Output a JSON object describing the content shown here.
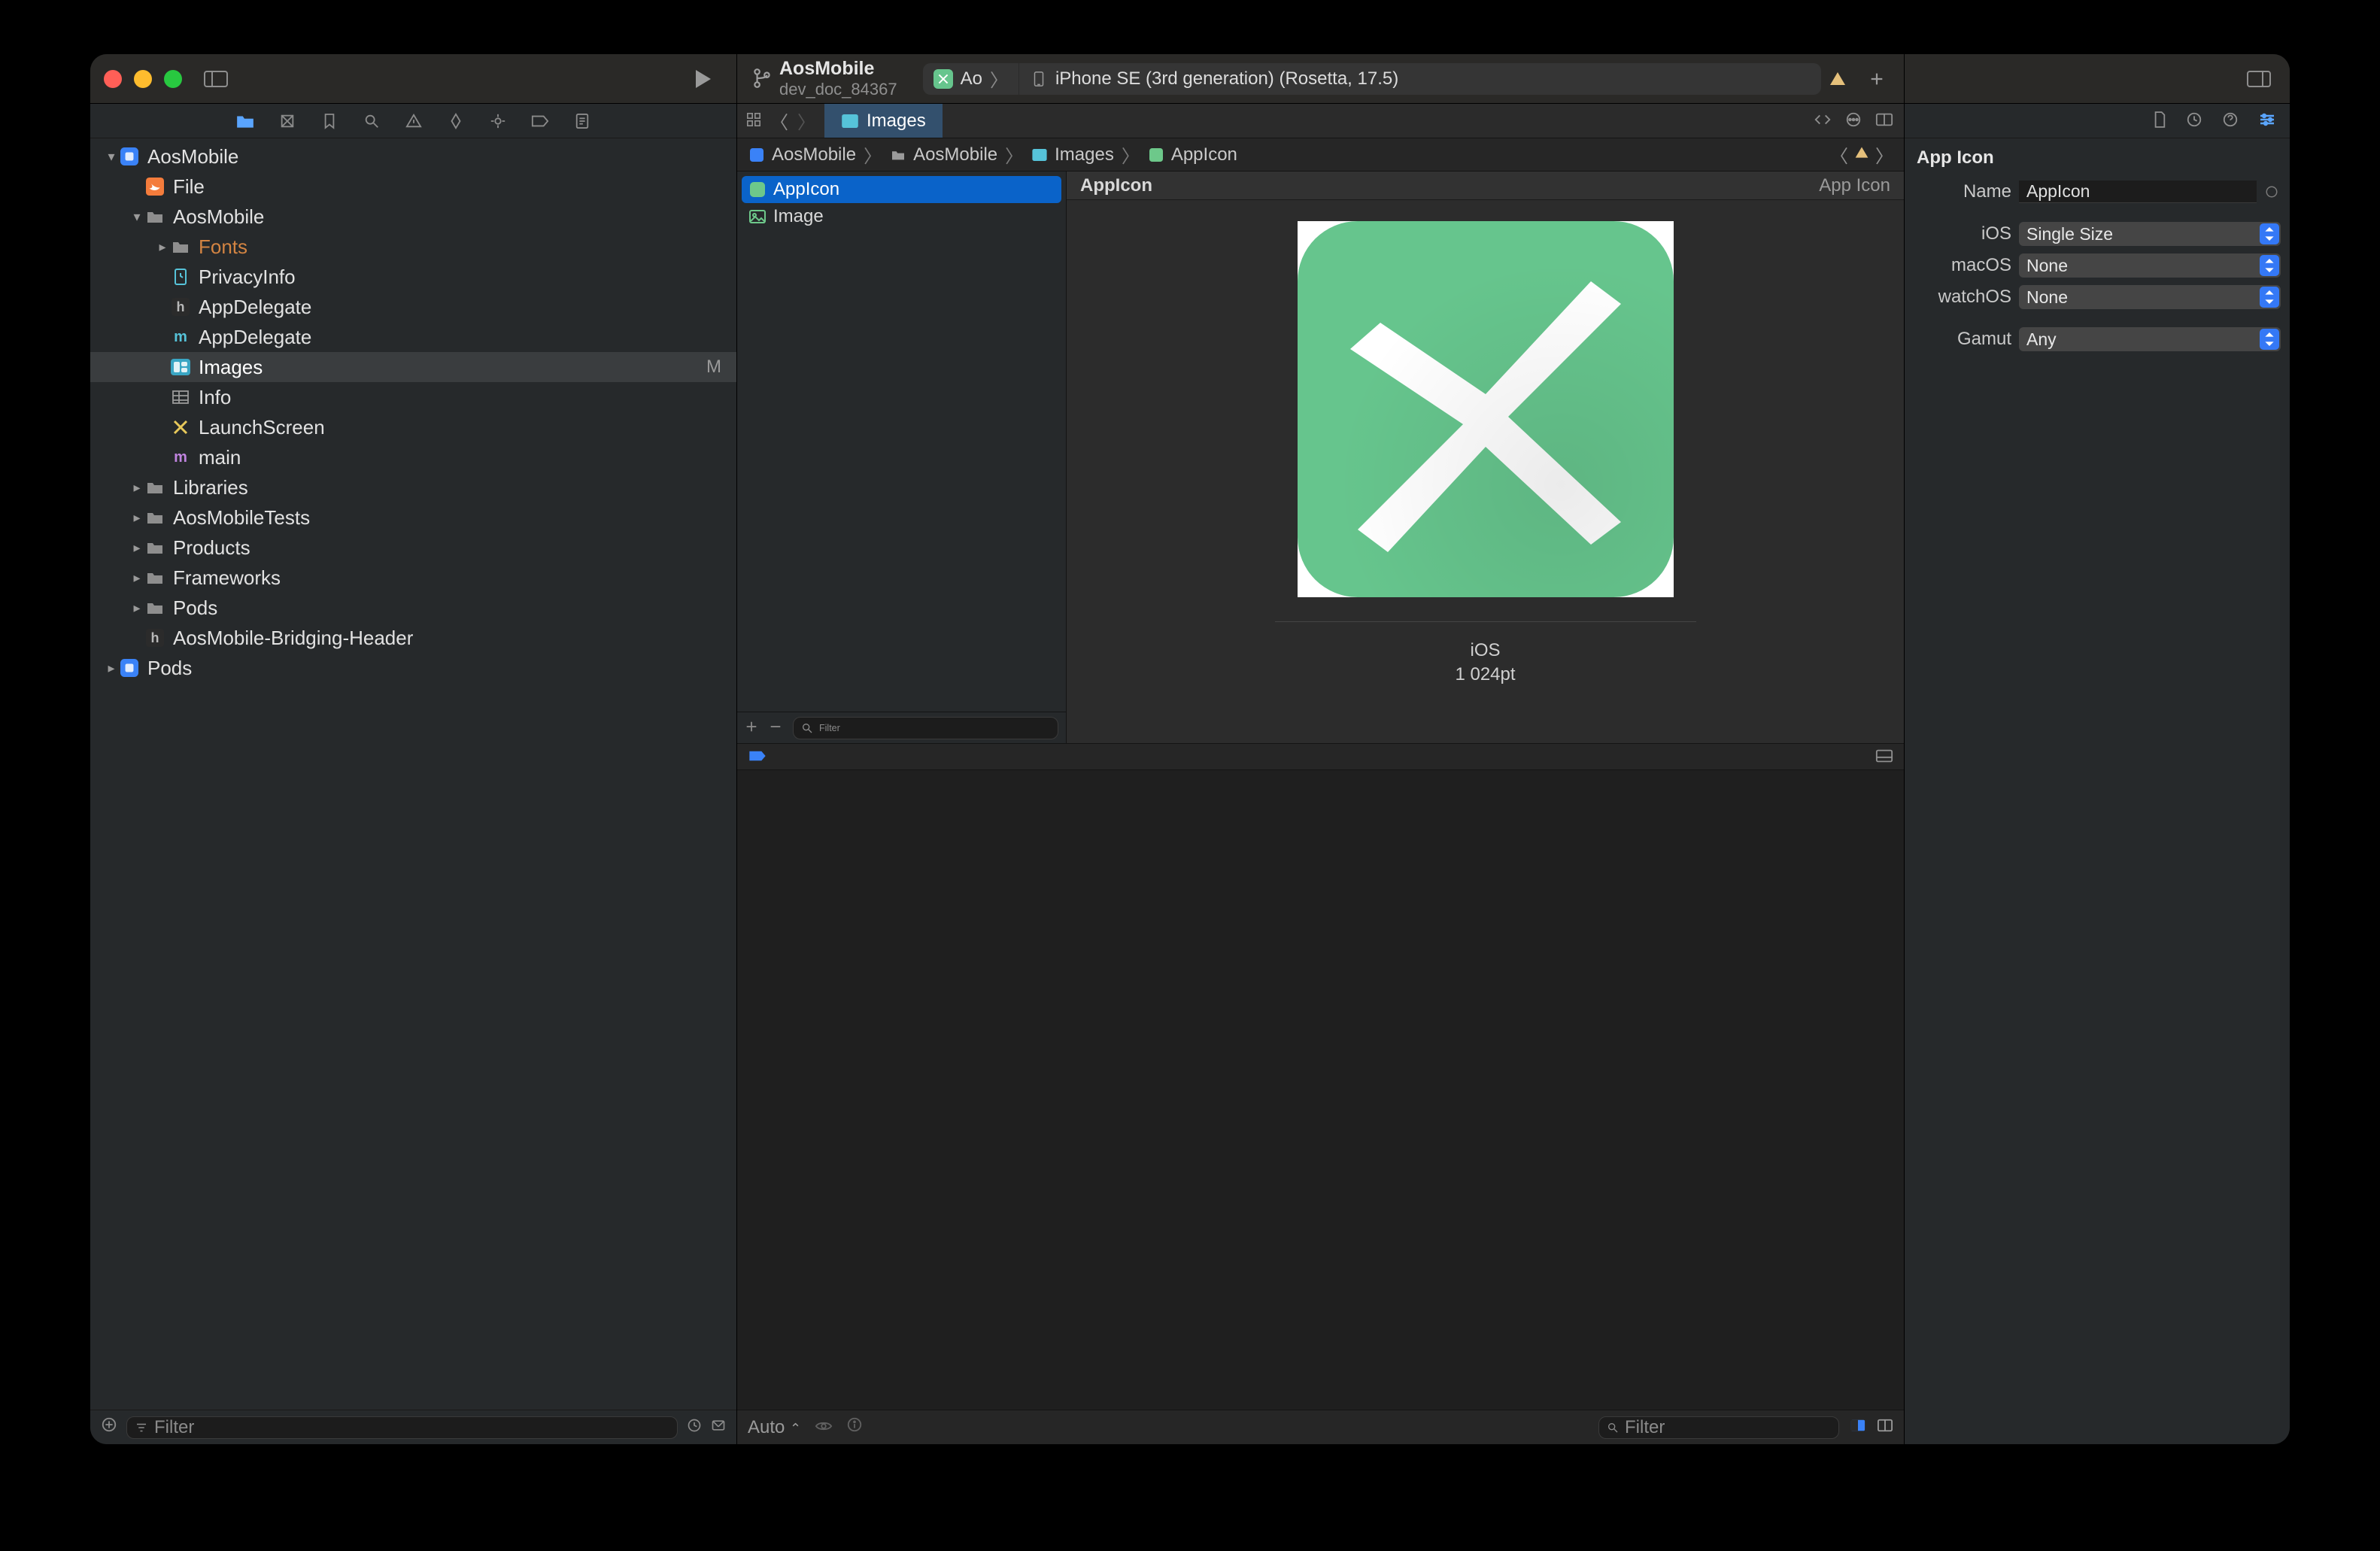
{
  "titlebar": {
    "project": "AosMobile",
    "branch": "dev_doc_84367",
    "scheme_short": "Ao",
    "destination": "iPhone SE (3rd generation) (Rosetta, 17.5)"
  },
  "nav": {
    "filter_placeholder": "Filter",
    "items": [
      {
        "depth": 0,
        "disc": "v",
        "icon": "app-blue",
        "label": "AosMobile"
      },
      {
        "depth": 1,
        "disc": "",
        "icon": "swift",
        "label": "File"
      },
      {
        "depth": 1,
        "disc": "v",
        "icon": "folder",
        "label": "AosMobile"
      },
      {
        "depth": 2,
        "disc": ">",
        "icon": "folder",
        "label": "Fonts",
        "orange": true
      },
      {
        "depth": 2,
        "disc": "",
        "icon": "privacy",
        "label": "PrivacyInfo"
      },
      {
        "depth": 2,
        "disc": "",
        "icon": "h",
        "label": "AppDelegate"
      },
      {
        "depth": 2,
        "disc": "",
        "icon": "m",
        "label": "AppDelegate"
      },
      {
        "depth": 2,
        "disc": "",
        "icon": "assets",
        "label": "Images",
        "selected": true,
        "badge": "M"
      },
      {
        "depth": 2,
        "disc": "",
        "icon": "plist",
        "label": "Info"
      },
      {
        "depth": 2,
        "disc": "",
        "icon": "storyboard",
        "label": "LaunchScreen"
      },
      {
        "depth": 2,
        "disc": "",
        "icon": "m-purple",
        "label": "main"
      },
      {
        "depth": 1,
        "disc": ">",
        "icon": "folder",
        "label": "Libraries"
      },
      {
        "depth": 1,
        "disc": ">",
        "icon": "folder",
        "label": "AosMobileTests"
      },
      {
        "depth": 1,
        "disc": ">",
        "icon": "folder",
        "label": "Products"
      },
      {
        "depth": 1,
        "disc": ">",
        "icon": "folder",
        "label": "Frameworks"
      },
      {
        "depth": 1,
        "disc": ">",
        "icon": "folder",
        "label": "Pods"
      },
      {
        "depth": 1,
        "disc": "",
        "icon": "h",
        "label": "AosMobile-Bridging-Header"
      },
      {
        "depth": 0,
        "disc": ">",
        "icon": "app-blue",
        "label": "Pods"
      }
    ]
  },
  "tabs": {
    "active": "Images"
  },
  "path": {
    "crumbs": [
      "AosMobile",
      "AosMobile",
      "Images",
      "AppIcon"
    ]
  },
  "assets": {
    "items": [
      {
        "label": "AppIcon",
        "selected": true,
        "kind": "appicon"
      },
      {
        "label": "Image",
        "selected": false,
        "kind": "image"
      }
    ],
    "filter_placeholder": "Filter"
  },
  "canvas": {
    "title": "AppIcon",
    "type_label": "App Icon",
    "slot_platform": "iOS",
    "slot_size": "1 024pt"
  },
  "footer": {
    "auto": "Auto",
    "filter_placeholder": "Filter"
  },
  "inspector": {
    "section": "App Icon",
    "name_label": "Name",
    "name_value": "AppIcon",
    "ios_label": "iOS",
    "ios_value": "Single Size",
    "mac_label": "macOS",
    "mac_value": "None",
    "watch_label": "watchOS",
    "watch_value": "None",
    "gamut_label": "Gamut",
    "gamut_value": "Any"
  }
}
